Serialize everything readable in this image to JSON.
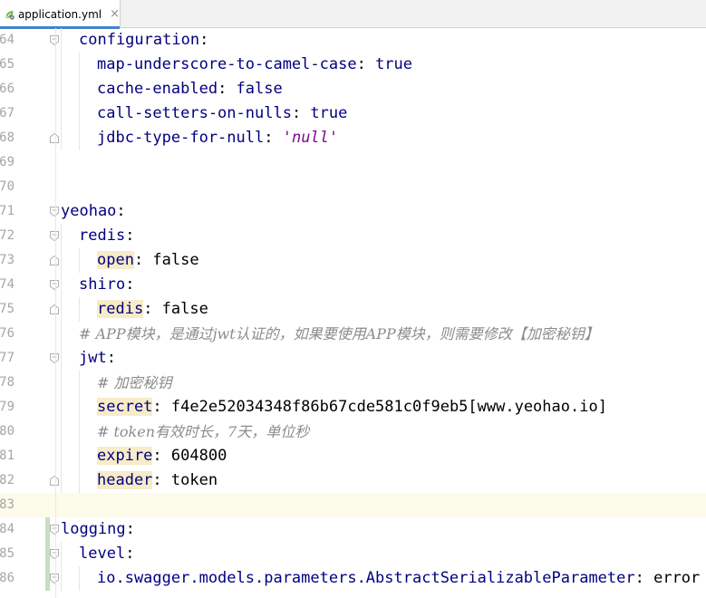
{
  "tab": {
    "title": "application.yml",
    "close": "×"
  },
  "colors": {
    "key": "#000080",
    "string": "#7a0a8c",
    "comment": "#8c8c8c",
    "tab_accent": "#4083c9"
  },
  "lines": [
    {
      "num": "64",
      "indent": 1,
      "parts": [
        {
          "t": "configuration",
          "c": "key"
        },
        {
          "t": ":"
        }
      ]
    },
    {
      "num": "65",
      "indent": 2,
      "parts": [
        {
          "t": "map-underscore-to-camel-case",
          "c": "key"
        },
        {
          "t": ": "
        },
        {
          "t": "true",
          "c": "key"
        }
      ]
    },
    {
      "num": "66",
      "indent": 2,
      "parts": [
        {
          "t": "cache-enabled",
          "c": "key"
        },
        {
          "t": ": "
        },
        {
          "t": "false",
          "c": "key"
        }
      ]
    },
    {
      "num": "67",
      "indent": 2,
      "parts": [
        {
          "t": "call-setters-on-nulls",
          "c": "key"
        },
        {
          "t": ": "
        },
        {
          "t": "true",
          "c": "key"
        }
      ]
    },
    {
      "num": "68",
      "indent": 2,
      "parts": [
        {
          "t": "jdbc-type-for-null",
          "c": "key"
        },
        {
          "t": ": "
        },
        {
          "t": "'null'",
          "c": "str"
        }
      ]
    },
    {
      "num": "69",
      "indent": 0,
      "parts": []
    },
    {
      "num": "70",
      "indent": 0,
      "parts": []
    },
    {
      "num": "71",
      "indent": 0,
      "parts": [
        {
          "t": "yeohao",
          "c": "key"
        },
        {
          "t": ":"
        }
      ]
    },
    {
      "num": "72",
      "indent": 1,
      "parts": [
        {
          "t": "redis",
          "c": "key"
        },
        {
          "t": ":"
        }
      ]
    },
    {
      "num": "73",
      "indent": 2,
      "parts": [
        {
          "t": "open",
          "c": "key hl"
        },
        {
          "t": ": false"
        }
      ]
    },
    {
      "num": "74",
      "indent": 1,
      "parts": [
        {
          "t": "shiro",
          "c": "key"
        },
        {
          "t": ":"
        }
      ]
    },
    {
      "num": "75",
      "indent": 2,
      "parts": [
        {
          "t": "redis",
          "c": "key hl"
        },
        {
          "t": ": false"
        }
      ]
    },
    {
      "num": "76",
      "indent": 1,
      "parts": [
        {
          "t": "# APP模块，是通过jwt认证的，如果要使用APP模块，则需要修改【加密秘钥】",
          "c": "comment"
        }
      ]
    },
    {
      "num": "77",
      "indent": 1,
      "parts": [
        {
          "t": "jwt",
          "c": "key"
        },
        {
          "t": ":"
        }
      ]
    },
    {
      "num": "78",
      "indent": 2,
      "parts": [
        {
          "t": "# 加密秘钥",
          "c": "comment"
        }
      ]
    },
    {
      "num": "79",
      "indent": 2,
      "parts": [
        {
          "t": "secret",
          "c": "key hl"
        },
        {
          "t": ": f4e2e52034348f86b67cde581c0f9eb5[www.yeohao.io]"
        }
      ]
    },
    {
      "num": "80",
      "indent": 2,
      "parts": [
        {
          "t": "# token有效时长，7天，单位秒",
          "c": "comment"
        }
      ]
    },
    {
      "num": "81",
      "indent": 2,
      "parts": [
        {
          "t": "expire",
          "c": "key hl"
        },
        {
          "t": ": 604800"
        }
      ]
    },
    {
      "num": "82",
      "indent": 2,
      "parts": [
        {
          "t": "header",
          "c": "key hl"
        },
        {
          "t": ": token"
        }
      ]
    },
    {
      "num": "83",
      "indent": 0,
      "parts": [],
      "current": true
    },
    {
      "num": "84",
      "indent": 0,
      "parts": [
        {
          "t": "logging",
          "c": "key"
        },
        {
          "t": ":"
        }
      ],
      "vcs": true
    },
    {
      "num": "85",
      "indent": 1,
      "parts": [
        {
          "t": "level",
          "c": "key"
        },
        {
          "t": ":"
        }
      ],
      "vcs": true
    },
    {
      "num": "86",
      "indent": 2,
      "parts": [
        {
          "t": "io.swagger.models.parameters.AbstractSerializableParameter",
          "c": "key"
        },
        {
          "t": ": error"
        }
      ],
      "vcs": true
    }
  ]
}
